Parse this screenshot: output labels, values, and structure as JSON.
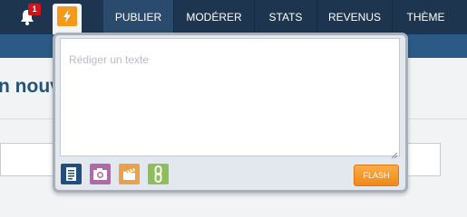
{
  "notifications": {
    "count": "1",
    "icon": "bell-icon"
  },
  "flash_tab": {
    "icon": "lightning-icon",
    "color": "#f39a1c"
  },
  "nav": {
    "items": [
      {
        "label": "PUBLIER"
      },
      {
        "label": "MODÉRER"
      },
      {
        "label": "STATS"
      },
      {
        "label": "REVENUS"
      },
      {
        "label": "THÈME"
      }
    ]
  },
  "page": {
    "heading": "n nouv"
  },
  "composer": {
    "placeholder": "Rédiger un texte",
    "tools": [
      "document-icon",
      "camera-icon",
      "video-icon",
      "link-icon"
    ],
    "submit_label": "FLASH"
  },
  "colors": {
    "nav_background": "#1e3550",
    "strip": "#2b5a86",
    "badge": "#d0141b",
    "submit": "#f39a1c"
  }
}
